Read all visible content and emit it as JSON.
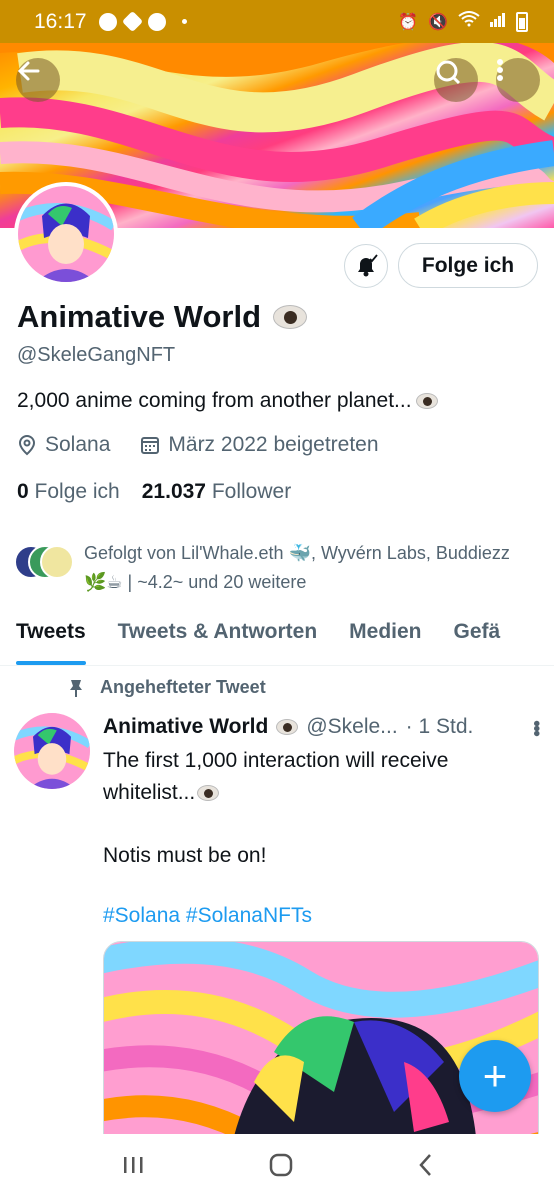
{
  "status_bar": {
    "time": "16:17"
  },
  "profile": {
    "name": "Animative World",
    "handle": "@SkeleGangNFT",
    "bio": "2,000 anime coming from another planet...",
    "location": "Solana",
    "joined": "März 2022 beigetreten",
    "following_count": "0",
    "following_label": "Folge ich",
    "followers_count": "21.037",
    "followers_label": "Follower",
    "follow_button_label": "Folge ich",
    "followed_by": "Gefolgt von Lil'Whale.eth 🐳, Wyvérn Labs, Buddiezz 🌿☕ | ~4.2~ und 20 weitere"
  },
  "tabs": [
    {
      "label": "Tweets"
    },
    {
      "label": "Tweets & Antworten"
    },
    {
      "label": "Medien"
    },
    {
      "label": "Gefä"
    }
  ],
  "pinned_tweet": {
    "pinned_label": "Angehefteter Tweet",
    "author": "Animative World",
    "handle": "@Skele...",
    "time": "· 1 Std.",
    "line1": "The first 1,000 interaction will receive",
    "line2": "whitelist...",
    "line3": "Notis must be on!",
    "hashtags": "#Solana #SolanaNFTs"
  },
  "icons": {
    "back": "back-arrow-icon",
    "search": "search-icon",
    "more": "more-vertical-icon",
    "bell": "bell-icon",
    "location": "location-pin-icon",
    "calendar": "calendar-icon",
    "pin": "pin-icon",
    "compose": "plus-icon"
  },
  "colors": {
    "accent": "#1d9bf0",
    "status_bar": "#c98f00"
  }
}
